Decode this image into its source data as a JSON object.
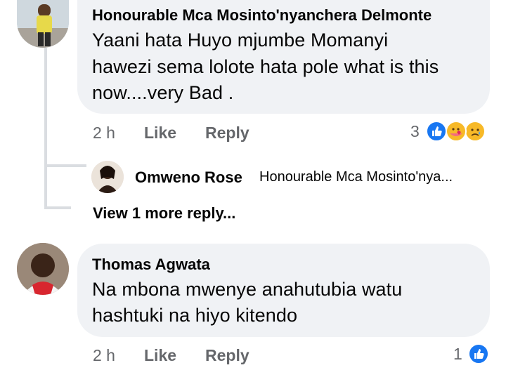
{
  "comments": [
    {
      "author": "Honourable Mca Mosinto'nyanchera Delmonte",
      "lines": [
        "Yaani hata Huyo mjumbe Momanyi",
        "hawezi sema lolote hata pole what is this",
        "now....very Bad ."
      ],
      "time": "2 h",
      "like_label": "Like",
      "reply_label": "Reply",
      "reaction_count": "3",
      "reactions": [
        "like-icon",
        "care-icon",
        "sad-icon"
      ]
    },
    {
      "author": "Thomas Agwata",
      "lines": [
        "Na mbona mwenye anahutubia watu",
        "hashtuki na hiyo kitendo"
      ],
      "time": "2 h",
      "like_label": "Like",
      "reply_label": "Reply",
      "reaction_count": "1",
      "reactions": [
        "like-icon"
      ]
    }
  ],
  "reply_preview": {
    "author": "Omweno Rose",
    "text": "Honourable Mca Mosinto'nya..."
  },
  "view_more": "View 1 more reply...",
  "colors": {
    "bubble": "#f0f2f5",
    "meta": "#65676b",
    "like_blue": "#1877f2",
    "reaction_yellow": "#f7b928"
  }
}
